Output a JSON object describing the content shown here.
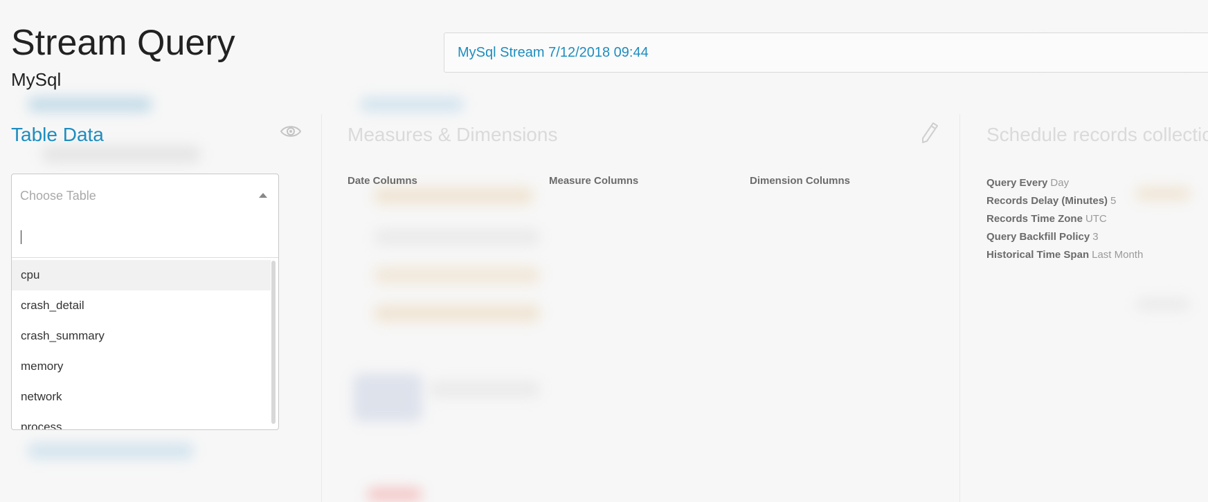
{
  "header": {
    "title": "Stream Query",
    "subtitle": "MySql",
    "stream_name": "MySql Stream 7/12/2018 09:44"
  },
  "table_data": {
    "title": "Table Data",
    "select": {
      "placeholder": "Choose Table",
      "search_value": "",
      "options": [
        "cpu",
        "crash_detail",
        "crash_summary",
        "memory",
        "network",
        "process"
      ],
      "highlighted_option": "cpu"
    }
  },
  "measures": {
    "title": "Measures & Dimensions",
    "columns": {
      "date": "Date Columns",
      "measure": "Measure Columns",
      "dimension": "Dimension Columns"
    }
  },
  "schedule": {
    "title": "Schedule records collection",
    "rows": [
      {
        "label": "Query Every",
        "value": "Day"
      },
      {
        "label": "Records Delay (Minutes)",
        "value": "5"
      },
      {
        "label": "Records Time Zone",
        "value": "UTC"
      },
      {
        "label": "Query Backfill Policy",
        "value": "3"
      },
      {
        "label": "Historical Time Span",
        "value": "Last Month"
      }
    ]
  },
  "icons": {
    "eye": "eye-icon",
    "pencil": "pencil-icon",
    "caret": "caret-up-icon"
  },
  "colors": {
    "accent": "#1d8dbf",
    "faded_title": "#dadada",
    "label": "#6b6b6b",
    "value": "#9a9a9a"
  }
}
